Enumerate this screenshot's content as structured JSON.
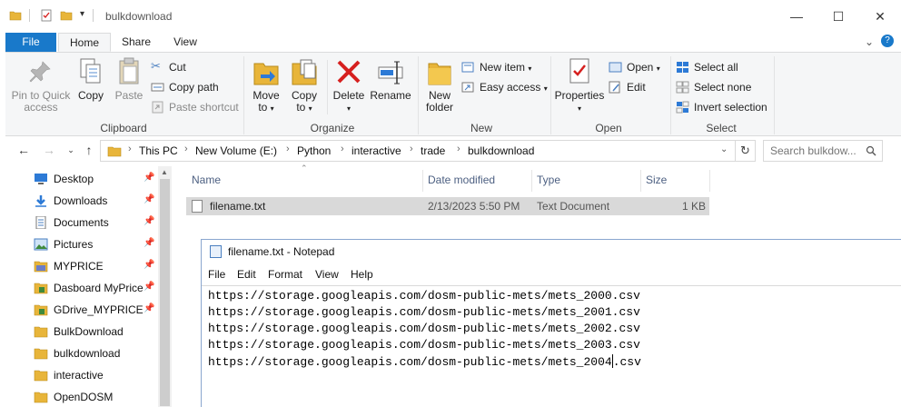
{
  "titlebar": {
    "title": "bulkdownload",
    "minimize": "—",
    "maximize": "☐",
    "close": "✕"
  },
  "ribbon_tabs": {
    "file": "File",
    "home": "Home",
    "share": "Share",
    "view": "View"
  },
  "ribbon": {
    "clipboard": {
      "label": "Clipboard",
      "pin_to_quick_access_line1": "Pin to Quick",
      "pin_to_quick_access_line2": "access",
      "copy": "Copy",
      "paste": "Paste",
      "cut": "Cut",
      "copy_path": "Copy path",
      "paste_shortcut": "Paste shortcut"
    },
    "organize": {
      "label": "Organize",
      "move_to_line1": "Move",
      "move_to_line2": "to",
      "copy_to_line1": "Copy",
      "copy_to_line2": "to",
      "delete": "Delete",
      "rename": "Rename"
    },
    "new": {
      "label": "New",
      "new_folder_line1": "New",
      "new_folder_line2": "folder",
      "new_item": "New item",
      "easy_access": "Easy access"
    },
    "open": {
      "label": "Open",
      "properties": "Properties",
      "open": "Open",
      "edit": "Edit"
    },
    "select": {
      "label": "Select",
      "select_all": "Select all",
      "select_none": "Select none",
      "invert_selection": "Invert selection"
    }
  },
  "address": {
    "crumbs": [
      "This PC",
      "New Volume (E:)",
      "Python",
      "interactive",
      "trade",
      "bulkdownload"
    ]
  },
  "search": {
    "placeholder": "Search bulkdow..."
  },
  "nav_pane": {
    "items": [
      {
        "label": "Desktop",
        "icon": "desktop-icon",
        "pinned": true
      },
      {
        "label": "Downloads",
        "icon": "downloads-icon",
        "pinned": true
      },
      {
        "label": "Documents",
        "icon": "documents-icon",
        "pinned": true
      },
      {
        "label": "Pictures",
        "icon": "pictures-icon",
        "pinned": true
      },
      {
        "label": "MYPRICE",
        "icon": "folder-icon",
        "pinned": true
      },
      {
        "label": "Dasboard MyPrice",
        "icon": "folder-icon",
        "pinned": true
      },
      {
        "label": "GDrive_MYPRICE",
        "icon": "folder-icon",
        "pinned": true
      },
      {
        "label": "BulkDownload",
        "icon": "folder-icon",
        "pinned": false
      },
      {
        "label": "bulkdownload",
        "icon": "folder-icon",
        "pinned": false
      },
      {
        "label": "interactive",
        "icon": "folder-icon",
        "pinned": false
      },
      {
        "label": "OpenDOSM",
        "icon": "folder-icon",
        "pinned": false
      }
    ]
  },
  "file_list": {
    "columns": {
      "name": "Name",
      "date_modified": "Date modified",
      "type": "Type",
      "size": "Size"
    },
    "rows": [
      {
        "name": "filename.txt",
        "date_modified": "2/13/2023 5:50 PM",
        "type": "Text Document",
        "size": "1 KB"
      }
    ]
  },
  "notepad": {
    "title": "filename.txt - Notepad",
    "menu": {
      "file": "File",
      "edit": "Edit",
      "format": "Format",
      "view": "View",
      "help": "Help"
    },
    "lines": [
      "https://storage.googleapis.com/dosm-public-mets/mets_2000.csv",
      "https://storage.googleapis.com/dosm-public-mets/mets_2001.csv",
      "https://storage.googleapis.com/dosm-public-mets/mets_2002.csv",
      "https://storage.googleapis.com/dosm-public-mets/mets_2003.csv"
    ],
    "last_line_before_caret": "https://storage.googleapis.com/dosm-public-mets/mets_2004",
    "last_line_after_caret": ".csv"
  },
  "colors": {
    "file_tab": "#1979ca",
    "folder": "#e8b53a",
    "selection": "#d9d9d9",
    "column_header": "#4d6082",
    "delete_red": "#d6201f"
  }
}
